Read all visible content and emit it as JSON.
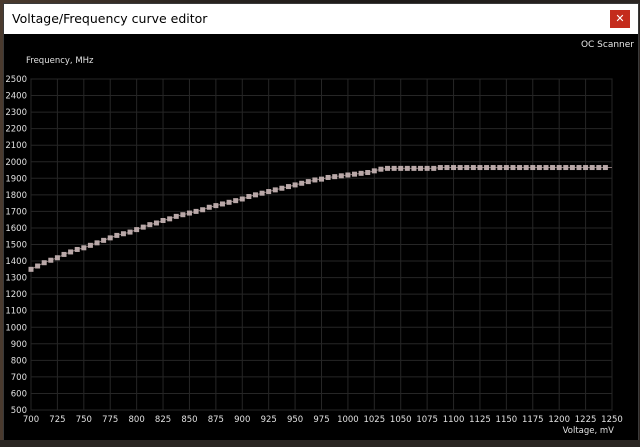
{
  "window": {
    "title": "Voltage/Frequency curve editor",
    "close_glyph": "✕",
    "close_color": "#c42b1c"
  },
  "toolbar": {
    "oc_scanner_label": "OC Scanner"
  },
  "chart_data": {
    "type": "scatter",
    "title": "",
    "xlabel": "Voltage, mV",
    "ylabel": "Frequency, MHz",
    "xlim": [
      700,
      1250
    ],
    "ylim": [
      500,
      2500
    ],
    "grid": true,
    "x_ticks": [
      700,
      725,
      750,
      775,
      800,
      825,
      850,
      875,
      900,
      925,
      950,
      975,
      1000,
      1025,
      1050,
      1075,
      1100,
      1125,
      1150,
      1175,
      1200,
      1225,
      1250
    ],
    "y_ticks": [
      500,
      600,
      700,
      800,
      900,
      1000,
      1100,
      1200,
      1300,
      1400,
      1500,
      1600,
      1700,
      1800,
      1900,
      2000,
      2100,
      2200,
      2300,
      2400,
      2500
    ],
    "marker_color": "#b9a8a8",
    "line_color": "#8a7777",
    "series": [
      {
        "x": [
          700,
          706.25,
          712.5,
          718.75,
          725,
          731.25,
          737.5,
          743.75,
          750,
          756.25,
          762.5,
          768.75,
          775,
          781.25,
          787.5,
          793.75,
          800,
          806.25,
          812.5,
          818.75,
          825,
          831.25,
          837.5,
          843.75,
          850,
          856.25,
          862.5,
          868.75,
          875,
          881.25,
          887.5,
          893.75,
          900,
          906.25,
          912.5,
          918.75,
          925,
          931.25,
          937.5,
          943.75,
          950,
          956.25,
          962.5,
          968.75,
          975,
          981.25,
          987.5,
          993.75,
          1000,
          1006.25,
          1012.5,
          1018.75,
          1025,
          1031.25,
          1037.5,
          1043.75,
          1050,
          1056.25,
          1062.5,
          1068.75,
          1075,
          1081.25,
          1087.5,
          1093.75,
          1100,
          1106.25,
          1112.5,
          1118.75,
          1125,
          1131.25,
          1137.5,
          1143.75,
          1150,
          1156.25,
          1162.5,
          1168.75,
          1175,
          1181.25,
          1187.5,
          1193.75,
          1200,
          1206.25,
          1212.5,
          1218.75,
          1225,
          1231.25,
          1237.5,
          1243.75
        ],
        "y": [
          1350,
          1370,
          1390,
          1405,
          1420,
          1440,
          1455,
          1470,
          1480,
          1495,
          1510,
          1525,
          1540,
          1555,
          1565,
          1575,
          1590,
          1605,
          1620,
          1630,
          1645,
          1655,
          1670,
          1680,
          1690,
          1700,
          1710,
          1725,
          1735,
          1745,
          1755,
          1765,
          1775,
          1790,
          1800,
          1810,
          1820,
          1830,
          1840,
          1850,
          1860,
          1870,
          1880,
          1890,
          1895,
          1905,
          1910,
          1915,
          1920,
          1925,
          1930,
          1935,
          1945,
          1955,
          1960,
          1960,
          1960,
          1960,
          1960,
          1960,
          1960,
          1960,
          1965,
          1965,
          1965,
          1965,
          1965,
          1965,
          1965,
          1965,
          1965,
          1965,
          1965,
          1965,
          1965,
          1965,
          1965,
          1965,
          1965,
          1965,
          1965,
          1965,
          1965,
          1965,
          1965,
          1965,
          1965,
          1965
        ]
      }
    ]
  }
}
